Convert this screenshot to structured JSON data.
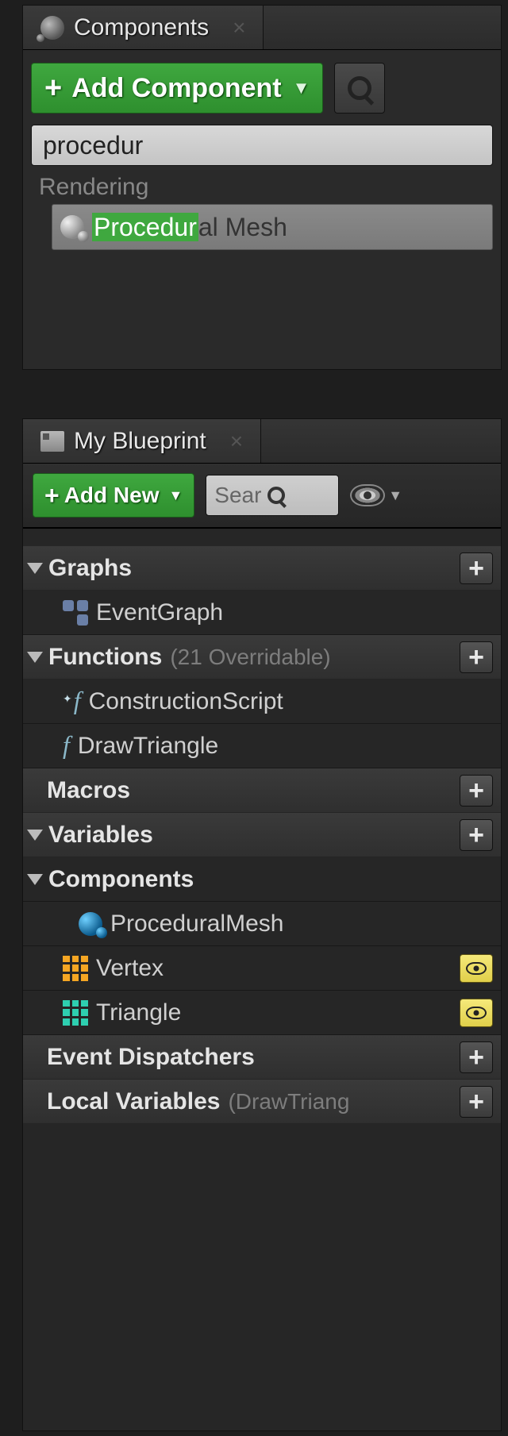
{
  "components_panel": {
    "title": "Components",
    "add_component_label": "Add Component",
    "search_value": "procedur",
    "category": "Rendering",
    "result_highlight": "Procedur",
    "result_rest": "al Mesh"
  },
  "myblueprint_panel": {
    "title": "My Blueprint",
    "add_new_label": "Add New",
    "search_placeholder": "Sear",
    "sections": {
      "graphs": {
        "label": "Graphs",
        "items": [
          {
            "label": "EventGraph"
          }
        ]
      },
      "functions": {
        "label": "Functions",
        "subtitle": "(21 Overridable)",
        "items": [
          {
            "label": "ConstructionScript"
          },
          {
            "label": "DrawTriangle"
          }
        ]
      },
      "macros": {
        "label": "Macros"
      },
      "variables": {
        "label": "Variables"
      },
      "components_sub": {
        "label": "Components",
        "items": [
          {
            "label": "ProceduralMesh"
          },
          {
            "label": "Vertex"
          },
          {
            "label": "Triangle"
          }
        ]
      },
      "event_dispatchers": {
        "label": "Event Dispatchers"
      },
      "local_variables": {
        "label": "Local Variables",
        "subtitle": "(DrawTriang"
      }
    }
  }
}
